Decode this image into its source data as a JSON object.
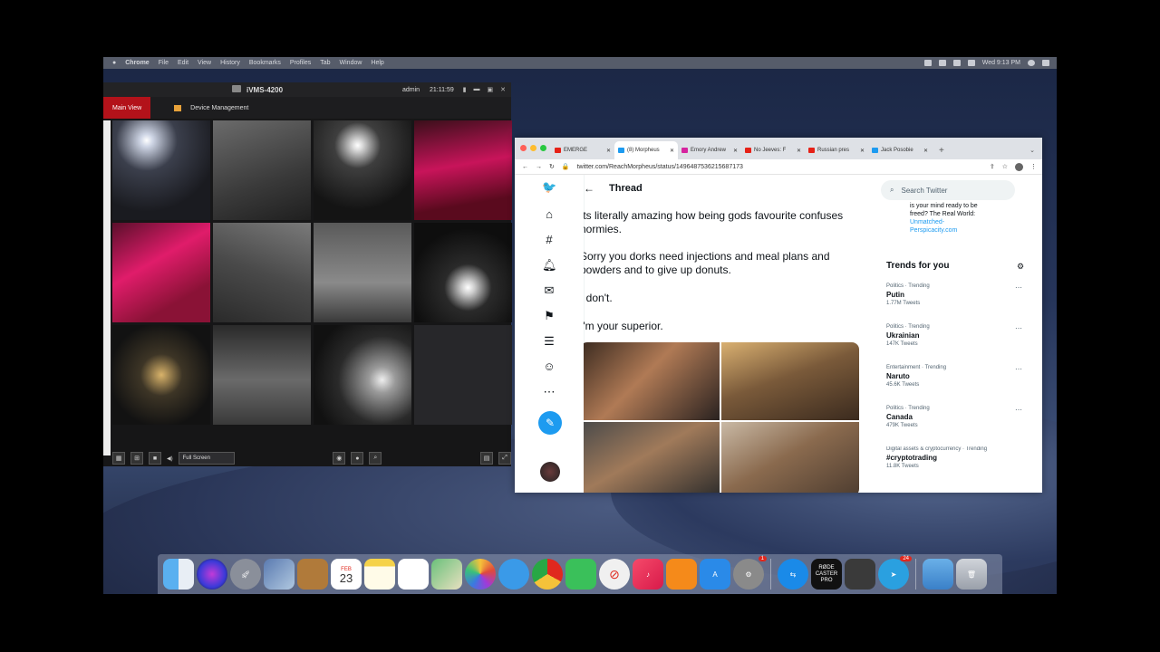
{
  "menubar": {
    "items": [
      "Chrome",
      "File",
      "Edit",
      "View",
      "History",
      "Bookmarks",
      "Profiles",
      "Tab",
      "Window",
      "Help"
    ],
    "right_status": "Wed 9:13 PM"
  },
  "ivms": {
    "app_name": "iVMS-4200",
    "user": "admin",
    "time": "21:11:59",
    "tabs": [
      "Main View",
      "Device Management"
    ],
    "layout_select": "Full Screen"
  },
  "browser": {
    "tabs": [
      {
        "label": "EMERGE",
        "icon": "youtube-icon",
        "color": "#e62117"
      },
      {
        "label": "(8) Morpheus",
        "icon": "twitter-icon",
        "color": "#1d9bf0"
      },
      {
        "label": "Emory Andrew",
        "icon": "instagram-icon",
        "color": "#d6249f"
      },
      {
        "label": "No Jeeves: F",
        "icon": "youtube-icon",
        "color": "#e62117"
      },
      {
        "label": "Russian pres",
        "icon": "youtube-icon",
        "color": "#e62117"
      },
      {
        "label": "Jack Posobie",
        "icon": "twitter-icon",
        "color": "#1d9bf0"
      }
    ],
    "url": "twitter.com/ReachMorpheus/status/1496487536215687173"
  },
  "twitter": {
    "thread_title": "Thread",
    "tweets": [
      "Its literally amazing how being gods favourite confuses normies.",
      "Sorry you dorks need injections and meal plans and powders and to give up donuts.",
      "I don't.",
      "I'm your superior."
    ],
    "search_placeholder": "Search Twitter",
    "sidebar_top": {
      "line1": "is your mind ready to be",
      "line2": "freed? The Real World:",
      "link1": "Unmatched-",
      "link2": "Perspicacity.com"
    },
    "trends_title": "Trends for you",
    "trends": [
      {
        "context": "Politics · Trending",
        "name": "Putin",
        "count": "1.77M Tweets"
      },
      {
        "context": "Politics · Trending",
        "name": "Ukrainian",
        "count": "147K Tweets"
      },
      {
        "context": "Entertainment · Trending",
        "name": "Naruto",
        "count": "45.6K Tweets"
      },
      {
        "context": "Politics · Trending",
        "name": "Canada",
        "count": "479K Tweets"
      },
      {
        "context": "Digital assets & cryptocurrency · Trending",
        "name": "#cryptotrading",
        "count": "11.8K Tweets"
      }
    ]
  },
  "dock": {
    "calendar_day": "23",
    "calendar_month": "FEB",
    "rode_label": "RØDE CASTER PRO",
    "telegram_badge": "24",
    "prefs_badge": "1"
  }
}
